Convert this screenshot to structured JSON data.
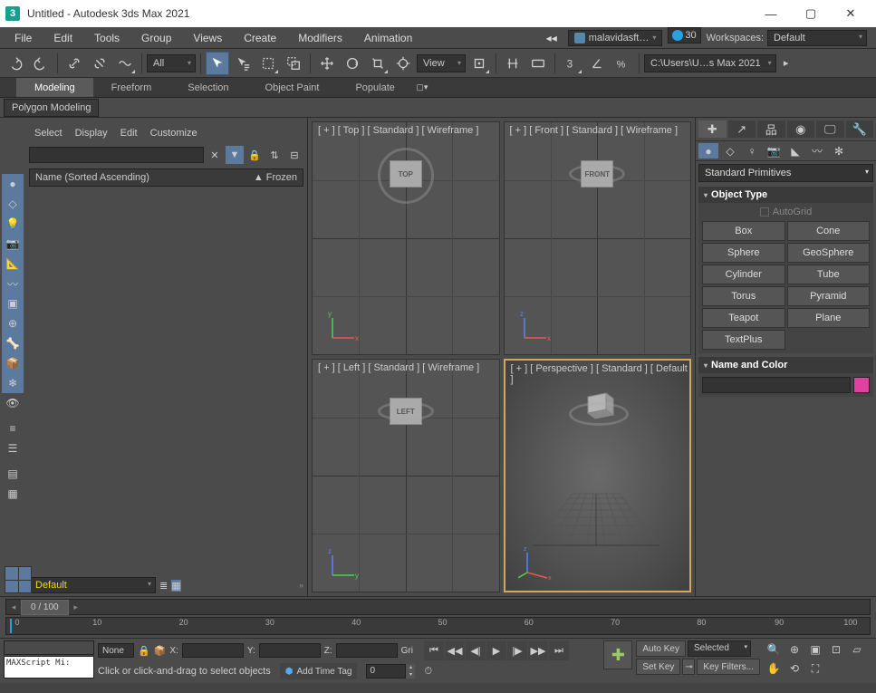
{
  "window": {
    "title": "Untitled - Autodesk 3ds Max 2021"
  },
  "menubar": {
    "items": [
      "File",
      "Edit",
      "Tools",
      "Group",
      "Views",
      "Create",
      "Modifiers",
      "Animation"
    ],
    "account": "malavidasft…",
    "time": "30",
    "workspaces_label": "Workspaces:",
    "workspace": "Default"
  },
  "maintoolbar": {
    "selector_all": "All",
    "selector_view": "View",
    "path": "C:\\Users\\U…s Max 2021"
  },
  "ribbon": {
    "tabs": [
      "Modeling",
      "Freeform",
      "Selection",
      "Object Paint",
      "Populate"
    ],
    "sub": "Polygon Modeling"
  },
  "explorer": {
    "menu": [
      "Select",
      "Display",
      "Edit",
      "Customize"
    ],
    "col_name": "Name (Sorted Ascending)",
    "col_frozen": "▲ Frozen",
    "layer_set": "Default"
  },
  "viewports": {
    "tl": "[ + ] [ Top ] [ Standard ] [ Wireframe ]",
    "tr": "[ + ] [ Front ] [ Standard ] [ Wireframe ]",
    "bl": "[ + ] [ Left ] [ Standard ] [ Wireframe ]",
    "br": "[ + ] [ Perspective ] [ Standard ] [ Default ]",
    "cube_tl": "TOP",
    "cube_tr": "FRONT",
    "cube_bl": "LEFT"
  },
  "cmdpanel": {
    "category": "Standard Primitives",
    "rollout_objtype": "Object Type",
    "autogrid": "AutoGrid",
    "primitives": [
      "Box",
      "Cone",
      "Sphere",
      "GeoSphere",
      "Cylinder",
      "Tube",
      "Torus",
      "Pyramid",
      "Teapot",
      "Plane",
      "TextPlus",
      ""
    ],
    "rollout_namecolor": "Name and Color"
  },
  "timeline": {
    "frame": "0 / 100",
    "ticks": [
      "0",
      "10",
      "20",
      "30",
      "40",
      "50",
      "60",
      "70",
      "80",
      "90",
      "100"
    ]
  },
  "status": {
    "maxscript": "MAXScript Mi:",
    "none": "None",
    "x": "X:",
    "y": "Y:",
    "z": "Z:",
    "grid": "Gri",
    "prompt": "Click or click-and-drag to select objects",
    "addtag": "Add Time Tag",
    "autokey": "Auto Key",
    "setkey": "Set Key",
    "selected": "Selected",
    "keyfilters": "Key Filters...",
    "frame0": "0"
  }
}
